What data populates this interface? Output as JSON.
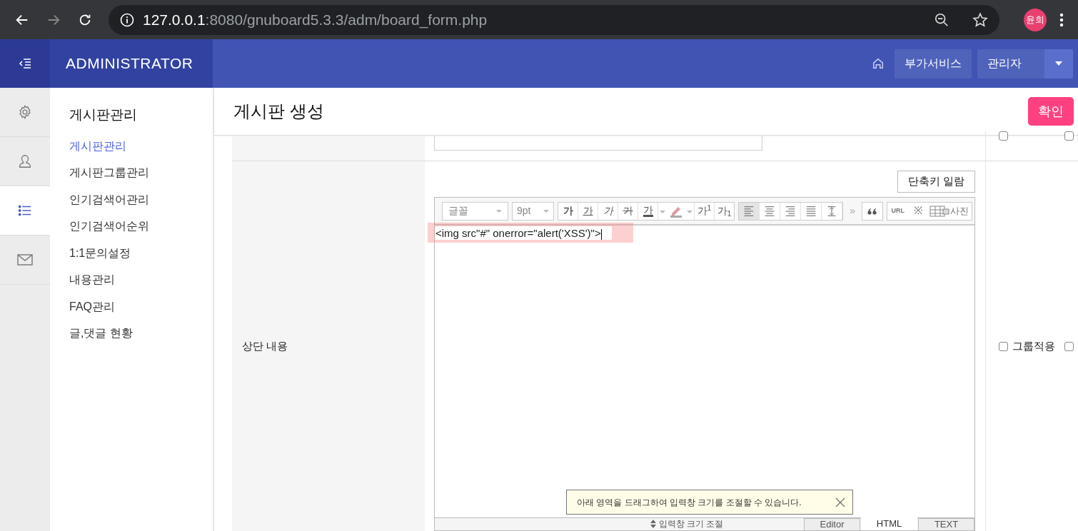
{
  "browser": {
    "url_host": "127.0.0.1",
    "url_path": ":8080/gnuboard5.3.3/adm/board_form.php",
    "profile": "윤희"
  },
  "header": {
    "title": "ADMINISTRATOR",
    "service_button": "부가서비스",
    "admin_button": "관리자"
  },
  "rail": [
    {
      "kind": "settings",
      "selected": false
    },
    {
      "kind": "user",
      "selected": false
    },
    {
      "kind": "list",
      "selected": true
    },
    {
      "kind": "mail",
      "selected": false
    }
  ],
  "nav": {
    "title": "게시판관리",
    "items": [
      {
        "label": "게시판관리",
        "selected": true
      },
      {
        "label": "게시판그룹관리",
        "selected": false
      },
      {
        "label": "인기검색어관리",
        "selected": false
      },
      {
        "label": "인기검색어순위",
        "selected": false
      },
      {
        "label": "1:1문의설정",
        "selected": false
      },
      {
        "label": "내용관리",
        "selected": false
      },
      {
        "label": "FAQ관리",
        "selected": false
      },
      {
        "label": "글,댓글 현황",
        "selected": false
      }
    ]
  },
  "page": {
    "title": "게시판 생성",
    "confirm_button": "확인"
  },
  "row_1": {
    "checkboxes": [
      {
        "checked": false
      },
      {
        "checked": false
      }
    ]
  },
  "row_2": {
    "label": "상단 내용",
    "shortcut_button": "단축키 일람",
    "toolbar": {
      "font": "글꼴",
      "size": "9pt",
      "format": [
        {
          "kind": "bold",
          "label": "가"
        },
        {
          "kind": "underline",
          "label": "가"
        },
        {
          "kind": "italic",
          "label": "가"
        },
        {
          "kind": "strike",
          "label": "가"
        },
        {
          "kind": "color",
          "label": "가"
        }
      ],
      "scripts": [
        "가$^{1}$",
        "가$_{1}$"
      ],
      "align": [
        {
          "kind": "left",
          "selected": true
        },
        {
          "kind": "center",
          "selected": false
        },
        {
          "kind": "right",
          "selected": false
        },
        {
          "kind": "justify",
          "selected": false
        },
        {
          "kind": "height",
          "selected": false
        }
      ],
      "more": "»",
      "url": "URL",
      "symbol": "※",
      "photo": "사진"
    },
    "content": "<img src\"#\" onerror=\"alert('XSS')\">",
    "resize_hint": "아래 영역을 드래그하여 입력창 크기를 조절할 수 있습니다.",
    "resize_label": "입력창 크기 조절",
    "modes": [
      {
        "label": "Editor",
        "selected": false
      },
      {
        "label": "HTML",
        "selected": true
      },
      {
        "label": "TEXT",
        "selected": false
      }
    ],
    "group_apply": {
      "label": "그룹적용",
      "checked": false
    },
    "extra_checkbox": {
      "checked": false
    }
  }
}
